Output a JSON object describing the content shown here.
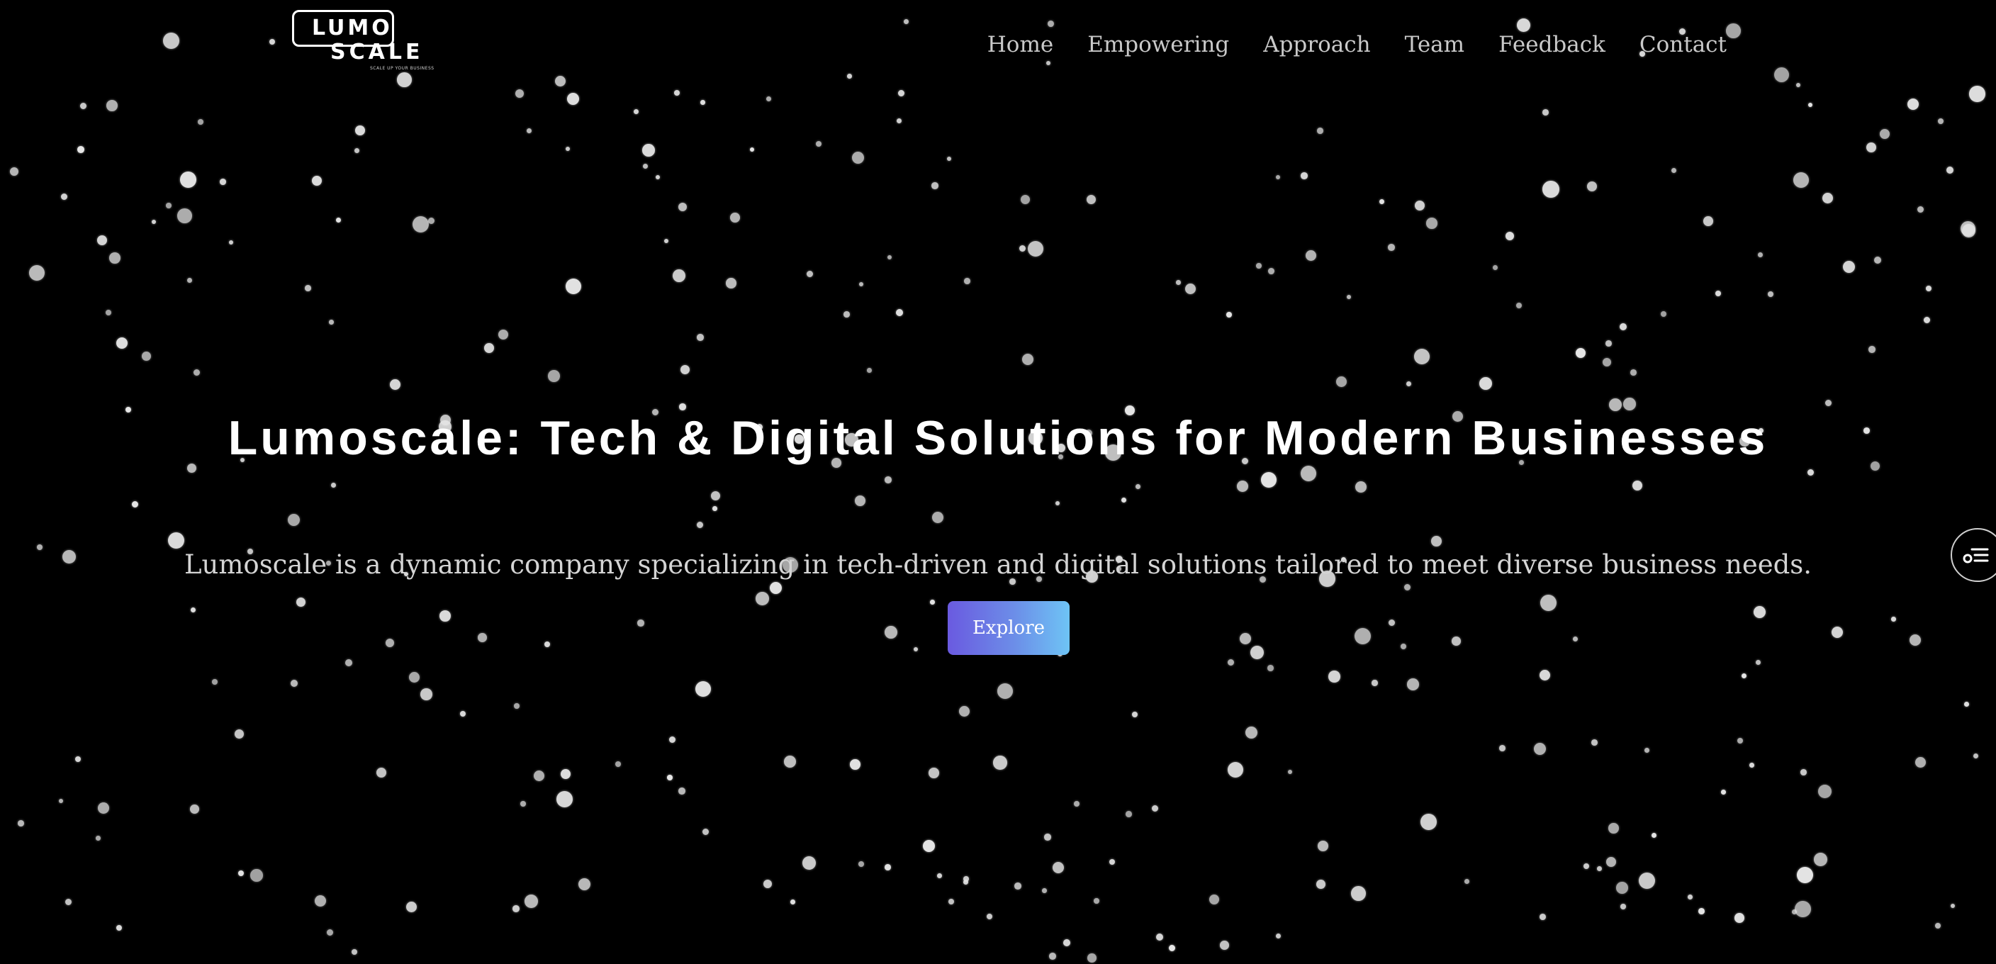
{
  "logo": {
    "line1": "LUMO",
    "line2": "SCALE",
    "tagline": "SCALE UP YOUR BUSINESS"
  },
  "nav": {
    "items": [
      "Home",
      "Empowering",
      "Approach",
      "Team",
      "Feedback",
      "Contact"
    ]
  },
  "hero": {
    "title": "Lumoscale: Tech & Digital Solutions for Modern Businesses",
    "subtitle": "Lumoscale is a dynamic company specializing in tech-driven and digital solutions tailored to meet diverse business needs.",
    "cta_label": "Explore"
  },
  "side_widget": {
    "icon": "settings-list-icon"
  },
  "colors": {
    "background": "#000000",
    "nav_text": "#c9c9c9",
    "title_text": "#ffffff",
    "subtitle_text": "#d4d4d4",
    "button_gradient_start": "#6a5ae0",
    "button_gradient_end": "#6ec4f5",
    "particle": "#e6e6e6"
  }
}
